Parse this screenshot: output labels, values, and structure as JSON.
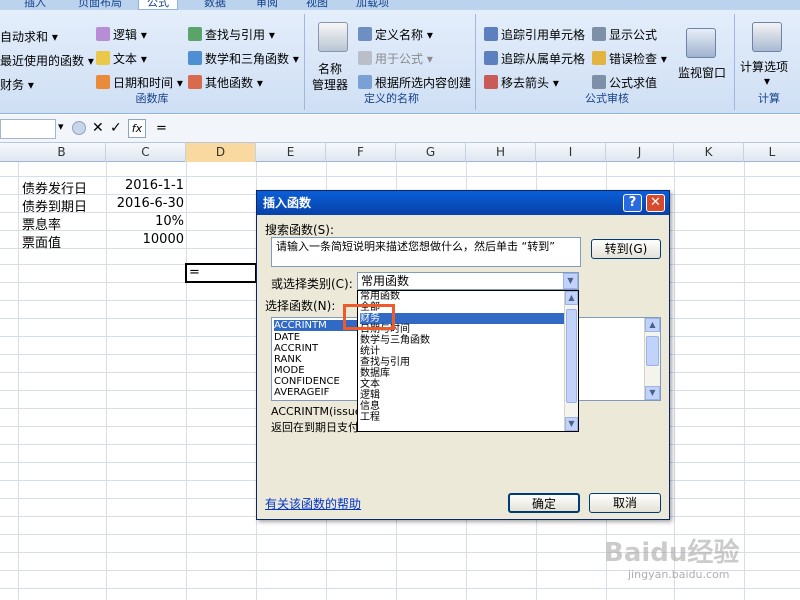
{
  "tabs": [
    "插入",
    "页面布局",
    "公式",
    "数据",
    "审阅",
    "视图",
    "加载项"
  ],
  "ribbon": {
    "lib": {
      "autosum": "自动求和",
      "recent": "最近使用的函数",
      "finance": "财务",
      "logic": "逻辑",
      "text": "文本",
      "datetime": "日期和时间",
      "lookup": "查找与引用",
      "math": "数学和三角函数",
      "other": "其他函数",
      "label": "函数库"
    },
    "names": {
      "manager_l1": "名称",
      "manager_l2": "管理器",
      "define": "定义名称",
      "use": "用于公式",
      "create": "根据所选内容创建",
      "label": "定义的名称"
    },
    "audit": {
      "trace_prec": "追踪引用单元格",
      "trace_dep": "追踪从属单元格",
      "remove": "移去箭头",
      "show": "显示公式",
      "check": "错误检查",
      "eval": "公式求值",
      "watch": "监视窗口",
      "label": "公式审核"
    },
    "calc": {
      "options": "计算选项",
      "label": "计算"
    }
  },
  "formula_bar": {
    "fx": "fx",
    "content": "="
  },
  "columns": [
    "B",
    "C",
    "D",
    "E",
    "F",
    "G",
    "H",
    "I",
    "J",
    "K",
    "L"
  ],
  "cells": [
    {
      "label": "债券发行日",
      "value": "2016-1-1"
    },
    {
      "label": "债券到期日",
      "value": "2016-6-30"
    },
    {
      "label": "票息率",
      "value": "10%"
    },
    {
      "label": "票面值",
      "value": "10000"
    }
  ],
  "active_cell": "=",
  "dialog": {
    "title": "插入函数",
    "search_label": "搜索函数(S):",
    "search_placeholder": "请输入一条简短说明来描述您想做什么，然后单击 “转到”",
    "goto": "转到(G)",
    "category_label": "或选择类别(C):",
    "category_value": "常用函数",
    "select_label": "选择函数(N):",
    "functions": [
      "ACCRINTM",
      "DATE",
      "ACCRINT",
      "RANK",
      "MODE",
      "CONFIDENCE",
      "AVERAGEIF"
    ],
    "desc_sig": "ACCRINTM(issue,...",
    "desc_text": "返回在到期日支付...",
    "help": "有关该函数的帮助",
    "ok": "确定",
    "cancel": "取消",
    "categories": [
      "常用函数",
      "全部",
      "财务",
      "日期与时间",
      "数学与三角函数",
      "统计",
      "查找与引用",
      "数据库",
      "文本",
      "逻辑",
      "信息",
      "工程"
    ]
  },
  "watermark": {
    "brand": "Baidu经验",
    "url": "jingyan.baidu.com"
  }
}
